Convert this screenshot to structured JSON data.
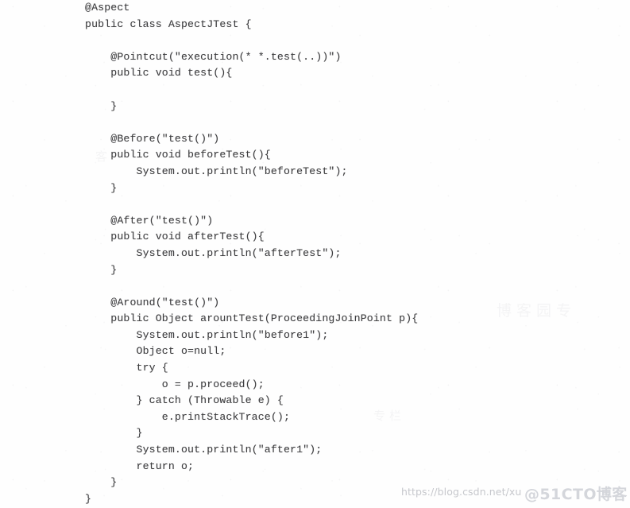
{
  "document": {
    "language": "java",
    "class_name": "AspectJTest",
    "code_lines": [
      "@Aspect",
      "public class AspectJTest {",
      "",
      "    @Pointcut(\"execution(* *.test(..))\")",
      "    public void test(){",
      "",
      "    }",
      "",
      "    @Before(\"test()\")",
      "    public void beforeTest(){",
      "        System.out.println(\"beforeTest\");",
      "    }",
      "",
      "    @After(\"test()\")",
      "    public void afterTest(){",
      "        System.out.println(\"afterTest\");",
      "    }",
      "",
      "    @Around(\"test()\")",
      "    public Object arountTest(ProceedingJoinPoint p){",
      "        System.out.println(\"before1\");",
      "        Object o=null;",
      "        try {",
      "            o = p.proceed();",
      "        } catch (Throwable e) {",
      "            e.printStackTrace();",
      "        }",
      "        System.out.println(\"after1\");",
      "        return o;",
      "    }",
      "}"
    ]
  },
  "watermarks": {
    "csdn_url": "https://blog.csdn.net/xu",
    "cto_blog": "@51CTO博客",
    "ghost_a": "博客园专",
    "ghost_b": "客",
    "ghost_c": "专栏"
  },
  "colors": {
    "page_background": "#fefefe",
    "code_text": "#3c3c3e",
    "csdn_watermark": "#b0b2b8",
    "cto_watermark": "#d0d2d8"
  }
}
